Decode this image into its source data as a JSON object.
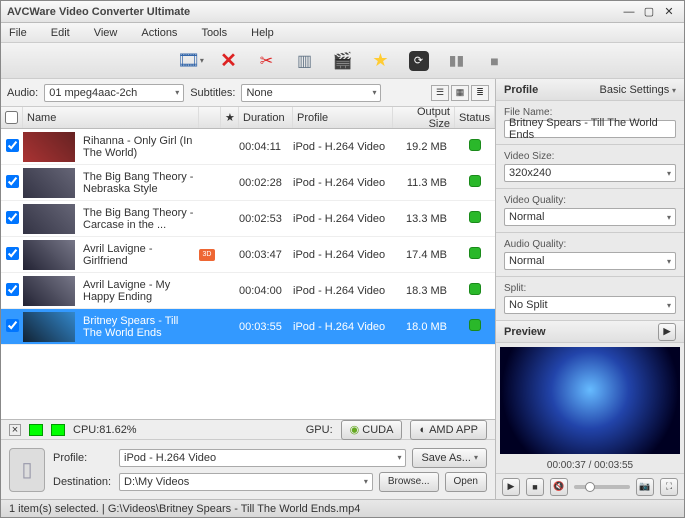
{
  "window": {
    "title": "AVCWare Video Converter Ultimate"
  },
  "menu": {
    "file": "File",
    "edit": "Edit",
    "view": "View",
    "actions": "Actions",
    "tools": "Tools",
    "help": "Help"
  },
  "filter": {
    "audio_label": "Audio:",
    "audio_value": "01 mpeg4aac-2ch",
    "subtitles_label": "Subtitles:",
    "subtitles_value": "None"
  },
  "columns": {
    "name": "Name",
    "duration": "Duration",
    "profile": "Profile",
    "output": "Output Size",
    "status": "Status"
  },
  "rows": [
    {
      "name": "Rihanna - Only Girl (In The World)",
      "dur": "00:04:11",
      "prof": "iPod - H.264 Video",
      "size": "19.2 MB",
      "thumb": "thumb-a",
      "badge": ""
    },
    {
      "name": "The Big Bang Theory - Nebraska Style",
      "dur": "00:02:28",
      "prof": "iPod - H.264 Video",
      "size": "11.3 MB",
      "thumb": "thumb-b",
      "badge": ""
    },
    {
      "name": "The Big Bang Theory - Carcase in the ...",
      "dur": "00:02:53",
      "prof": "iPod - H.264 Video",
      "size": "13.3 MB",
      "thumb": "thumb-b",
      "badge": ""
    },
    {
      "name": "Avril Lavigne - Girlfriend",
      "dur": "00:03:47",
      "prof": "iPod - H.264 Video",
      "size": "17.4 MB",
      "thumb": "thumb-c",
      "badge": "3D"
    },
    {
      "name": "Avril Lavigne - My Happy Ending",
      "dur": "00:04:00",
      "prof": "iPod - H.264 Video",
      "size": "18.3 MB",
      "thumb": "thumb-c",
      "badge": ""
    },
    {
      "name": "Britney Spears - Till The World Ends",
      "dur": "00:03:55",
      "prof": "iPod - H.264 Video",
      "size": "18.0 MB",
      "thumb": "thumb-d",
      "badge": ""
    }
  ],
  "cpu": {
    "label": "CPU:81.62%",
    "gpu_label": "GPU:",
    "cuda": "CUDA",
    "amd": "AMD APP"
  },
  "device": {
    "profile_label": "Profile:",
    "profile_value": "iPod - H.264 Video",
    "dest_label": "Destination:",
    "dest_value": "D:\\My Videos",
    "saveas": "Save As...",
    "browse": "Browse...",
    "open": "Open"
  },
  "status": {
    "text": "1 item(s) selected. | G:\\Videos\\Britney Spears - Till The World Ends.mp4"
  },
  "panel": {
    "profile": "Profile",
    "basic": "Basic Settings",
    "filename": "File Name:",
    "filename_value": "Britney Spears - Till The World Ends",
    "videosize": "Video Size:",
    "videosize_value": "320x240",
    "videoq": "Video Quality:",
    "videoq_value": "Normal",
    "audioq": "Audio Quality:",
    "audioq_value": "Normal",
    "split": "Split:",
    "split_value": "No Split",
    "preview": "Preview",
    "time": "00:00:37 / 00:03:55"
  }
}
